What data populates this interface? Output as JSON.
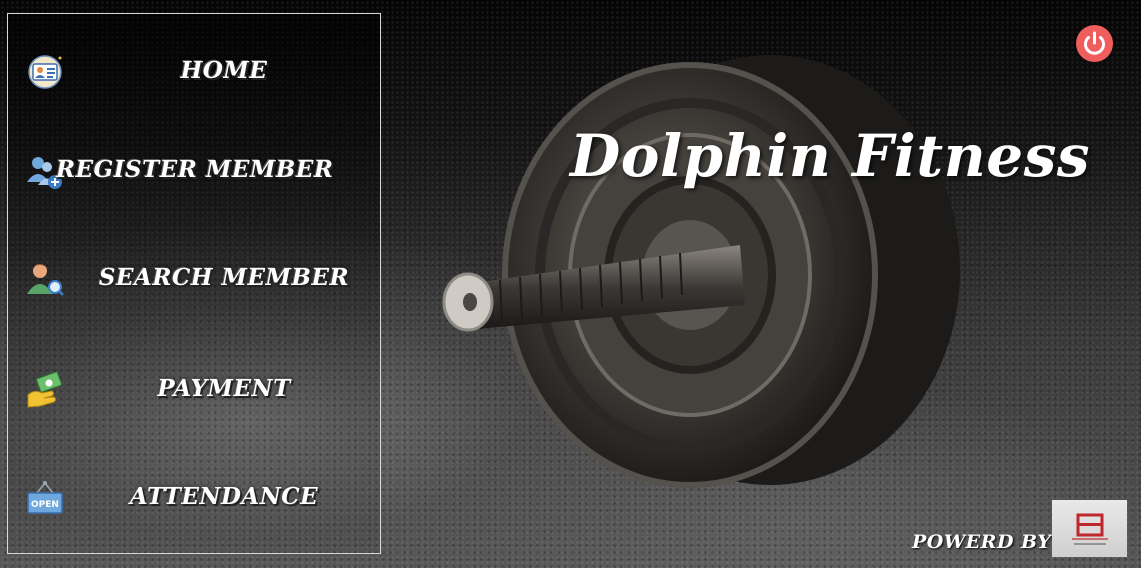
{
  "app": {
    "title": "Dolphin Fitness"
  },
  "sidebar": {
    "items": [
      {
        "label": "HOME",
        "icon": "id-card-icon"
      },
      {
        "label": "REGISTER MEMBER",
        "icon": "add-users-icon"
      },
      {
        "label": "SEARCH MEMBER",
        "icon": "search-user-icon"
      },
      {
        "label": "PAYMENT",
        "icon": "cash-payment-icon"
      },
      {
        "label": "ATTENDANCE",
        "icon": "open-sign-icon"
      }
    ]
  },
  "footer": {
    "powered_by": "POWERD BY",
    "logo_icon": "e-biz-extend-logo"
  },
  "controls": {
    "power_icon": "power-icon"
  },
  "colors": {
    "power_button": "#ef5d5d",
    "text": "#ffffff",
    "sidebar_border": "#d8d8d8"
  }
}
